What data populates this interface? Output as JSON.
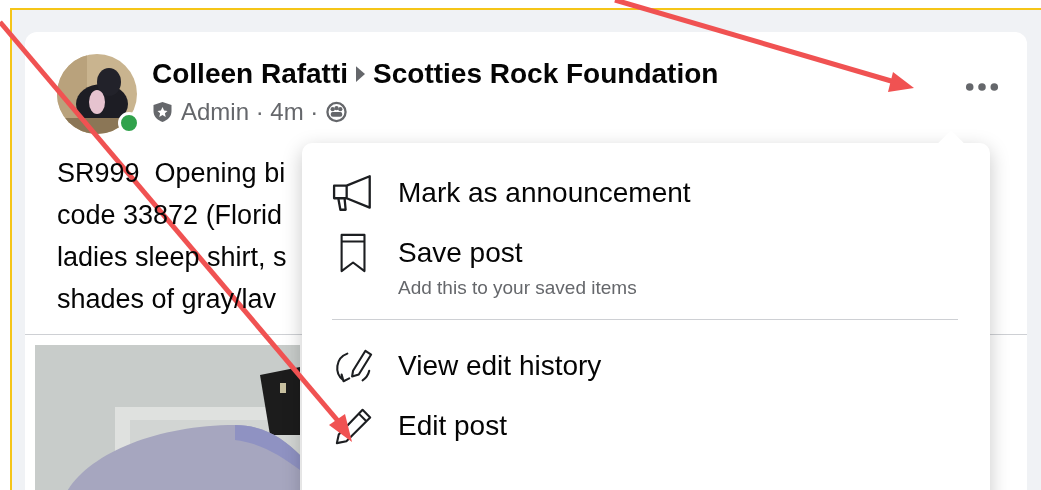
{
  "post": {
    "author": "Colleen Rafatti",
    "group": "Scotties Rock Foundation",
    "meta": "Admin · 4m ·",
    "online": true,
    "text_lines": [
      "SR999  Opening bi",
      "code 33872 (Florid",
      "ladies sleep shirt, s",
      "shades of gray/lav"
    ]
  },
  "menu": {
    "sections": [
      [
        {
          "kind": "megaphone",
          "label": "Mark as announcement"
        },
        {
          "kind": "bookmark",
          "label": "Save post",
          "hint": "Add this to your saved items"
        }
      ],
      [
        {
          "kind": "history",
          "label": "View edit history"
        },
        {
          "kind": "pencil",
          "label": "Edit post"
        }
      ]
    ]
  }
}
